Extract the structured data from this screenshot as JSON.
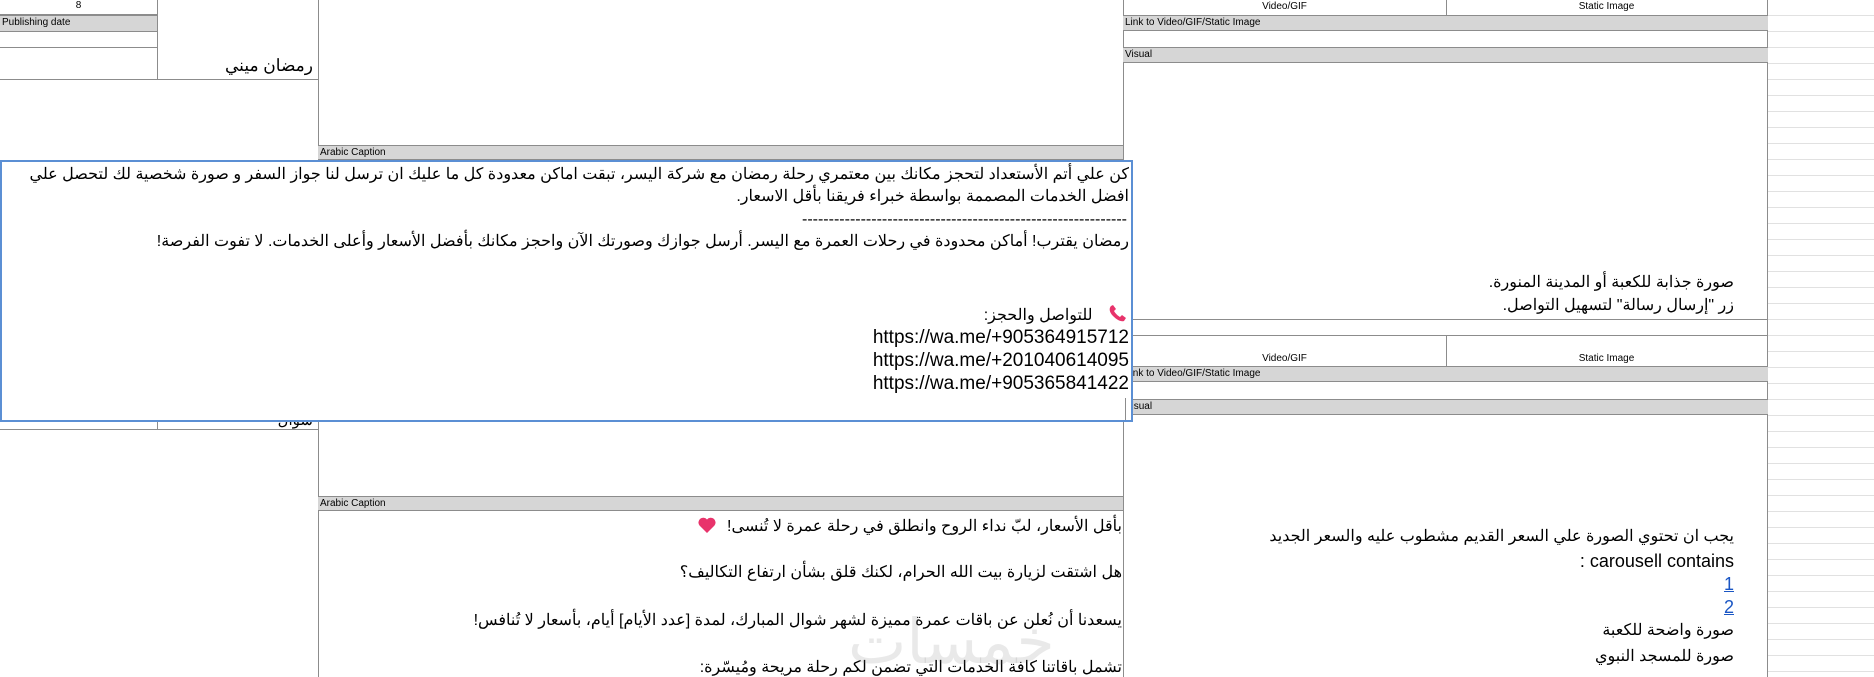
{
  "left_col": {
    "number": "8",
    "publishing_date_label": "Publishing date",
    "name_top": "رمضان ميني",
    "name_bottom": "شوال"
  },
  "top_block": {
    "video_gif": "Video/GIF",
    "static_image": "Static Image",
    "link_label": "Link to Video/GIF/Static Image",
    "visual_label": "Visual",
    "visual_line1": "صورة جذابة للكعبة أو المدينة المنورة.",
    "visual_line2": "زر \"إرسال رسالة\"  لتسهيل التواصل."
  },
  "caption_label_1": "Arabic Caption",
  "popup": {
    "line1": "كن علي أتم الأستعداد لتحجز مكانك بين معتمري رحلة رمضان مع شركة اليسر، تبقت اماكن معدودة كل ما عليك ان ترسل لنا جواز السفر و صورة شخصية لك لتحصل علي",
    "line2": "افضل الخدمات المصممة بواسطة خبراء فريقنا بأقل الاسعار.",
    "divider": "-------------------------------------------------------------",
    "line3": "رمضان يقترب! أماكن محدودة في رحلات العمرة مع اليسر. أرسل جوازك وصورتك الآن واحجز مكانك بأفضل الأسعار وأعلى الخدمات. لا تفوت الفرصة!",
    "contact": "للتواصل والحجز:",
    "urls": [
      "https://wa.me/+905364915712",
      "https://wa.me/+201040614095",
      "https://wa.me/+905365841422"
    ]
  },
  "bottom_block": {
    "video_gif": "Video/GIF",
    "static_image": "Static Image",
    "link_label": "Link to Video/GIF/Static Image",
    "visual_label": "Visual",
    "visual_line1": "يجب ان تحتوي الصورة علي السعر القديم مشطوب عليه والسعر الجديد",
    "visual_line2": "carousell contains :",
    "link1": "1",
    "link2": "2",
    "visual_line3": "صورة واضحة للكعبة",
    "visual_line4": "صورة للمسجد النبوي"
  },
  "caption_label_2": "Arabic Caption",
  "caption2": {
    "line1": "بأقل الأسعار، لبّ نداء الروح وانطلق في رحلة عمرة لا تُنسى!",
    "line2": "هل اشتقت لزيارة بيت الله الحرام، لكنك قلق بشأن ارتفاع التكاليف؟",
    "line3": "يسعدنا أن نُعلن عن باقات عمرة مميزة لشهر شوال المبارك، لمدة [عدد الأيام] أيام، بأسعار لا تُنافس!",
    "line4": "تشمل باقاتنا كافة الخدمات التي تضمن لكم رحلة مريحة ومُيسّرة:"
  },
  "watermark": "خمسات",
  "colors": {
    "header_gray": "#d6d6d6",
    "selection_blue": "#5b8fd4",
    "link_blue": "#1a56c4",
    "heart_pink": "#e8336b"
  }
}
